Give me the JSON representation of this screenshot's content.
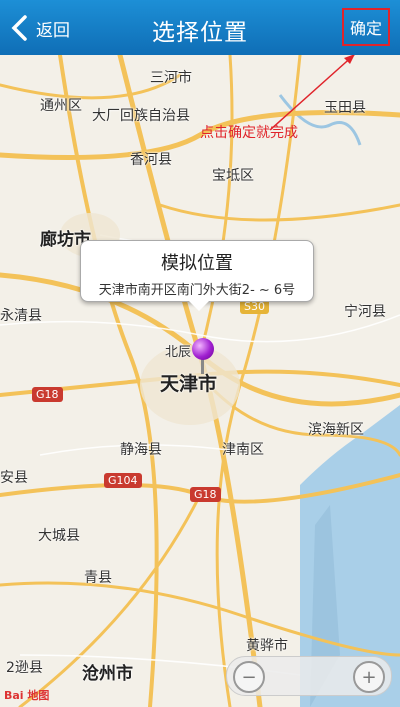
{
  "navbar": {
    "back_label": "返回",
    "title": "选择位置",
    "confirm_label": "确定"
  },
  "annotation": {
    "text": "点击确定就完成",
    "color": "#e0242b"
  },
  "callout": {
    "title": "模拟位置",
    "address": "天津市南开区南门外大街2- ~ 6号"
  },
  "map": {
    "places": [
      "三河市",
      "通州区",
      "大厂回族自治县",
      "玉田县",
      "香河县",
      "宝坻区",
      "廊坊市",
      "宁河县",
      "永清县",
      "北辰",
      "天津市",
      "滨海新区",
      "静海县",
      "津南区",
      "安县",
      "大城县",
      "青县",
      "黄骅市",
      "沧州市",
      "2逊县"
    ],
    "road_shields": [
      "G18",
      "G104",
      "G18",
      "S30"
    ],
    "logo": "Bai 地图"
  },
  "zoom": {
    "out_symbol": "−",
    "in_symbol": "+"
  },
  "colors": {
    "nav_blue": "#1481cc",
    "road": "#f3c259",
    "sea": "#a9cfe8"
  }
}
